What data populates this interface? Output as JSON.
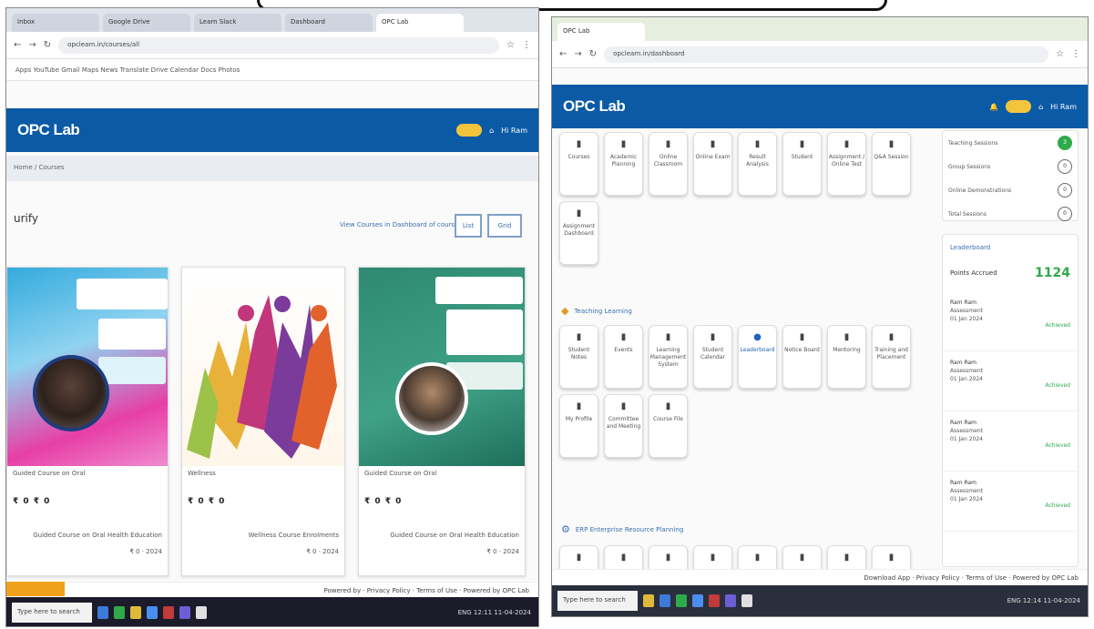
{
  "left": {
    "tabs": [
      "Inbox",
      "Google Drive",
      "Learn Slack",
      "Dashboard",
      "OPC Lab"
    ],
    "url": "opclearn.in/courses/all",
    "bookmarks": "Apps  YouTube  Gmail  Maps  News  Translate  Drive  Calendar  Docs  Photos",
    "appbar": {
      "brand": "OPC Lab",
      "user": "Hi Ram"
    },
    "subnav": "Home / Courses",
    "section_title": "urify",
    "view_all": "View Courses in Dashboard of courses",
    "btn_list": "List",
    "btn_grid": "Grid",
    "cards": [
      {
        "name": "Guided Course on Oral",
        "price": "₹ 0 ₹ 0",
        "desc": "Guided Course on Oral Health Education",
        "date": "₹ 0 · 2024"
      },
      {
        "name": "Wellness",
        "price": "₹ 0 ₹ 0",
        "desc": "Wellness Course Enrolments",
        "date": "₹ 0 · 2024"
      },
      {
        "name": "Guided Course on Oral",
        "price": "₹ 0 ₹ 0",
        "desc": "Guided Course on Oral Health Education",
        "date": "₹ 0 · 2024"
      }
    ],
    "footer": "Powered by  ·  Privacy Policy  ·  Terms of Use  ·  Powered by OPC Lab",
    "search_placeholder": "Type here to search",
    "clock": "ENG  12:11  11-04-2024"
  },
  "right": {
    "tabs": [
      "OPC Lab"
    ],
    "url": "opclearn.in/dashboard",
    "appbar": {
      "brand": "OPC Lab",
      "user": "Hi Ram"
    },
    "tiles_top": [
      "Courses",
      "Academic Planning",
      "Online Classroom",
      "Online Exam",
      "Result Analysis",
      "Student",
      "Assignment / Online Test",
      "Q&A Session",
      "Assignment Dashboard"
    ],
    "section_learning": "Teaching Learning",
    "tiles_learning": [
      "Student Notes",
      "Events",
      "Learning Management System",
      "Student Calendar",
      "Leaderboard",
      "Notice Board",
      "Mentoring",
      "Training and Placement",
      "My Profile",
      "Committee and Meeting",
      "Course File"
    ],
    "active_tile": "Leaderboard",
    "section_erp": "ERP Enterprise Resource Planning",
    "side_progress": [
      {
        "label": "Teaching Sessions",
        "count": "3",
        "green": true
      },
      {
        "label": "Group Sessions",
        "count": "0",
        "green": false
      },
      {
        "label": "Online Demonstrations",
        "count": "0",
        "green": false
      },
      {
        "label": "Total Sessions",
        "count": "0",
        "green": false
      }
    ],
    "leaderboard": {
      "title": "Leaderboard",
      "points_label": "Points Accrued",
      "points": "1124",
      "items": [
        {
          "title": "Ram Ram",
          "line1": "Assessment",
          "line2": "01 Jan 2024",
          "tag": "Achieved"
        },
        {
          "title": "Ram Ram",
          "line1": "Assessment",
          "line2": "01 Jan 2024",
          "tag": "Achieved"
        },
        {
          "title": "Ram Ram",
          "line1": "Assessment",
          "line2": "01 Jan 2024",
          "tag": "Achieved"
        },
        {
          "title": "Ram Ram",
          "line1": "Assessment",
          "line2": "01 Jan 2024",
          "tag": "Achieved"
        }
      ]
    },
    "footer": "Download App  ·  Privacy Policy  ·  Terms of Use  ·  Powered by OPC Lab",
    "search_placeholder": "Type here to search",
    "clock": "ENG  12:14  11-04-2024"
  }
}
